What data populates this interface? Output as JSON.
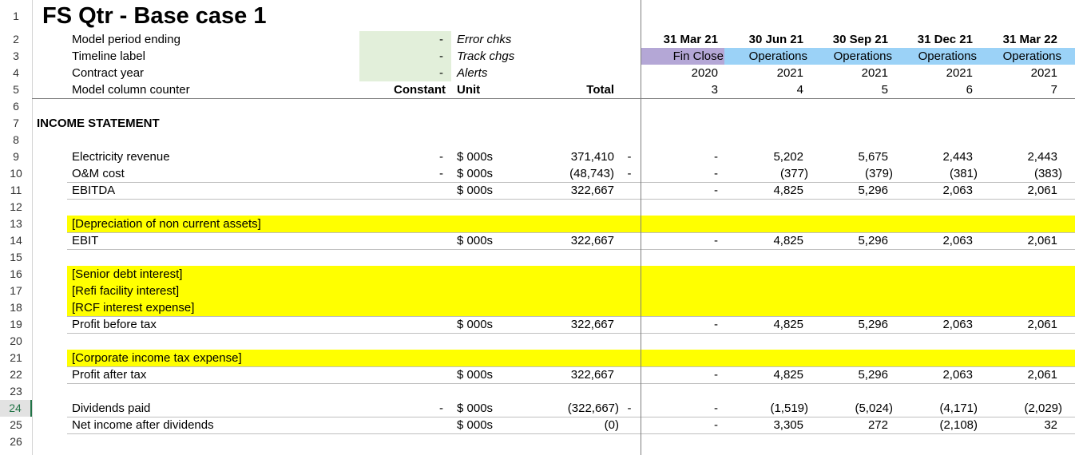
{
  "title": "FS Qtr - Base case 1",
  "colors": {
    "input_green": "#e2efda",
    "fin_close": "#b4a7d6",
    "operations": "#9bd2f7",
    "highlight": "#ffff00",
    "select_green": "#217346"
  },
  "row_numbers": [
    "1",
    "2",
    "3",
    "4",
    "5",
    "6",
    "7",
    "8",
    "9",
    "10",
    "11",
    "12",
    "13",
    "14",
    "15",
    "16",
    "17",
    "18",
    "19",
    "20",
    "21",
    "22",
    "23",
    "24",
    "25",
    "26"
  ],
  "header": {
    "labels": [
      "Model period ending",
      "Timeline label",
      "Contract year",
      "Model column counter"
    ],
    "dashes": [
      "-",
      "-",
      "-"
    ],
    "checks": [
      "Error chks",
      "Track chgs",
      "Alerts"
    ],
    "constant": "Constant",
    "unit": "Unit",
    "total": "Total"
  },
  "periods": [
    {
      "date": "31 Mar 21",
      "label": "Fin Close",
      "year": "2020",
      "counter": "3"
    },
    {
      "date": "30 Jun 21",
      "label": "Operations",
      "year": "2021",
      "counter": "4"
    },
    {
      "date": "30 Sep 21",
      "label": "Operations",
      "year": "2021",
      "counter": "5"
    },
    {
      "date": "31 Dec 21",
      "label": "Operations",
      "year": "2021",
      "counter": "6"
    },
    {
      "date": "31 Mar 22",
      "label": "Operations",
      "year": "2021",
      "counter": "7"
    }
  ],
  "section": "INCOME STATEMENT",
  "rows": [
    {
      "label": "Electricity revenue",
      "const": "-",
      "unit": "$ 000s",
      "total": "371,410",
      "flag": "-",
      "v": [
        "-",
        "5,202",
        "5,675",
        "2,443",
        "2,443"
      ]
    },
    {
      "label": "O&M cost",
      "const": "-",
      "unit": "$ 000s",
      "total": "(48,743)",
      "flag": "-",
      "v": [
        "-",
        "(377)",
        "(379)",
        "(381)",
        "(383)"
      ]
    },
    {
      "label": "EBITDA",
      "const": "",
      "unit": "$ 000s",
      "total": "322,667",
      "flag": "",
      "v": [
        "-",
        "4,825",
        "5,296",
        "2,063",
        "2,061"
      ]
    },
    {
      "label": "[Depreciation of non current assets]"
    },
    {
      "label": "EBIT",
      "const": "",
      "unit": "$ 000s",
      "total": "322,667",
      "flag": "",
      "v": [
        "-",
        "4,825",
        "5,296",
        "2,063",
        "2,061"
      ]
    },
    {
      "label": "[Senior debt interest]"
    },
    {
      "label": "[Refi facility interest]"
    },
    {
      "label": "[RCF interest expense]"
    },
    {
      "label": "Profit before tax",
      "const": "",
      "unit": "$ 000s",
      "total": "322,667",
      "flag": "",
      "v": [
        "-",
        "4,825",
        "5,296",
        "2,063",
        "2,061"
      ]
    },
    {
      "label": "[Corporate income tax expense]"
    },
    {
      "label": "Profit after tax",
      "const": "",
      "unit": "$ 000s",
      "total": "322,667",
      "flag": "",
      "v": [
        "-",
        "4,825",
        "5,296",
        "2,063",
        "2,061"
      ]
    },
    {
      "label": "Dividends paid",
      "const": "-",
      "unit": "$ 000s",
      "total": "(322,667)",
      "flag": "-",
      "v": [
        "-",
        "(1,519)",
        "(5,024)",
        "(4,171)",
        "(2,029)"
      ]
    },
    {
      "label": "Net income after dividends",
      "const": "",
      "unit": "$ 000s",
      "total": "(0)",
      "flag": "",
      "v": [
        "-",
        "3,305",
        "272",
        "(2,108)",
        "32"
      ]
    }
  ]
}
